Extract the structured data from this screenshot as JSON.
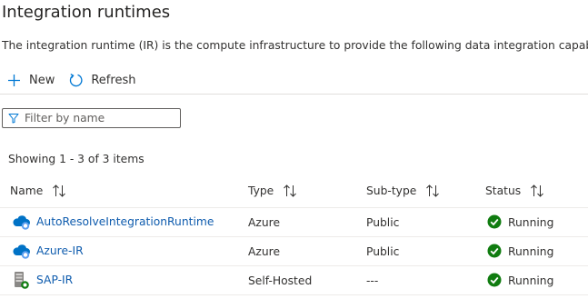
{
  "page": {
    "title": "Integration runtimes",
    "description": "The integration runtime (IR) is the compute infrastructure to provide the following data integration capabilities a"
  },
  "toolbar": {
    "new_label": "New",
    "new_icon": "plus-icon",
    "refresh_label": "Refresh",
    "refresh_icon": "refresh-icon"
  },
  "filter": {
    "placeholder": "Filter by name",
    "value": "",
    "icon": "filter-icon"
  },
  "summary": "Showing 1 - 3 of 3 items",
  "table": {
    "columns": [
      "Name",
      "Type",
      "Sub-type",
      "Status"
    ],
    "rows": [
      {
        "name": "AutoResolveIntegrationRuntime",
        "type": "Azure",
        "subtype": "Public",
        "status": "Running",
        "icon": "azure-cloud-icon"
      },
      {
        "name": "Azure-IR",
        "type": "Azure",
        "subtype": "Public",
        "status": "Running",
        "icon": "azure-cloud-icon"
      },
      {
        "name": "SAP-IR",
        "type": "Self-Hosted",
        "subtype": "---",
        "status": "Running",
        "icon": "self-hosted-server-icon"
      }
    ]
  },
  "colors": {
    "link": "#0f5cae",
    "accent": "#0078d4",
    "status_running": "#107c10",
    "divider": "#e1dfdd"
  }
}
